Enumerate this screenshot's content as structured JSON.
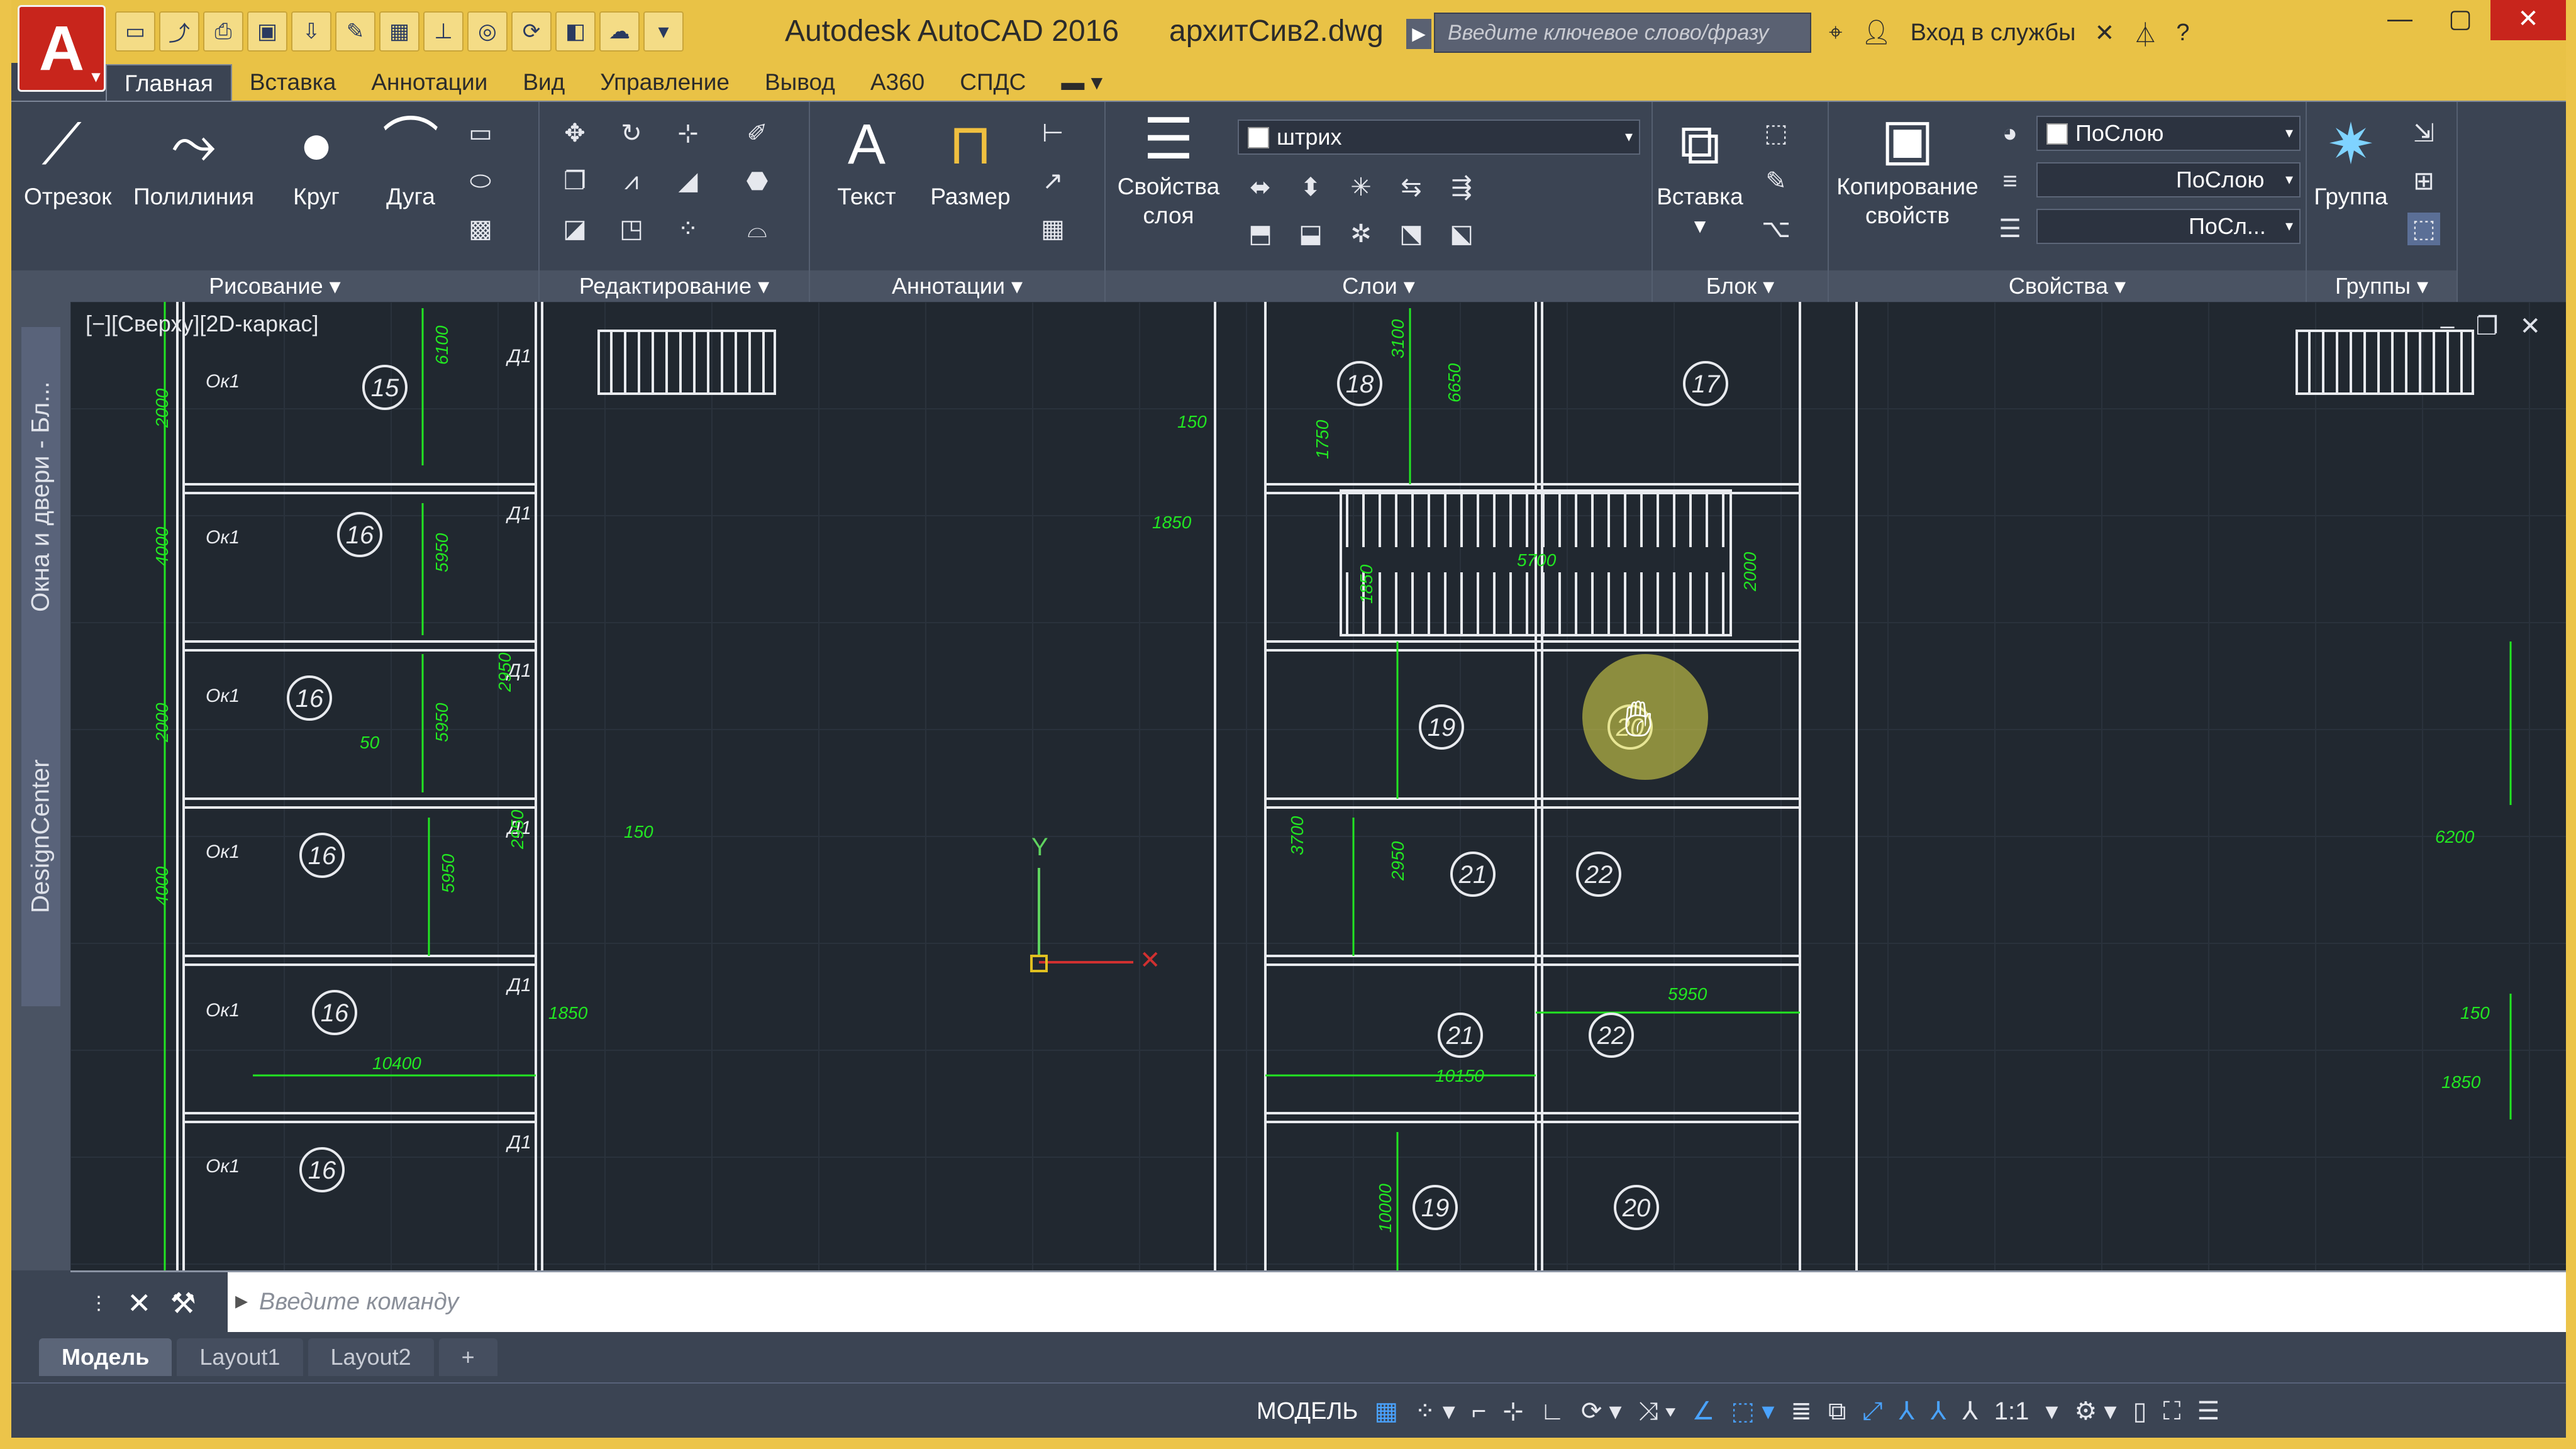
{
  "app": {
    "title": "Autodesk AutoCAD 2016",
    "file": "архитСив2.dwg"
  },
  "qat_icons": [
    "new-icon",
    "open-icon",
    "save-icon",
    "saveas-icon",
    "plot-icon",
    "undo-icon",
    "redo-icon",
    "layout-icon",
    "workspace-icon",
    "share-icon",
    "dropdown-icon"
  ],
  "search": {
    "placeholder": "Введите ключевое слово/фразу"
  },
  "signin": "Вход в службы",
  "tabs": [
    "Главная",
    "Вставка",
    "Аннотации",
    "Вид",
    "Управление",
    "Вывод",
    "A360",
    "СПДС"
  ],
  "ribbon": {
    "draw": {
      "title": "Рисование",
      "line": "Отрезок",
      "polyline": "Полилиния",
      "circle": "Круг",
      "arc": "Дуга"
    },
    "modify": {
      "title": "Редактирование"
    },
    "annotation": {
      "title": "Аннотации",
      "text": "Текст",
      "dimension": "Размер"
    },
    "layers": {
      "title": "Слои",
      "props_line1": "Свойства",
      "props_line2": "слоя",
      "current_layer": "штрих"
    },
    "block": {
      "title": "Блок",
      "insert": "Вставка"
    },
    "properties": {
      "title": "Свойства",
      "match_line1": "Копирование",
      "match_line2": "свойств",
      "color": "ПоСлою",
      "linetype": "ПоСлою",
      "lineweight": "ПоСл..."
    },
    "groups": {
      "title": "Группы",
      "group": "Группа"
    }
  },
  "side_palettes": [
    "Окна и двери - Бл...",
    "DesignCenter"
  ],
  "viewport": {
    "label": "[−][Сверху][2D-каркас]"
  },
  "drawing": {
    "rooms": [
      {
        "num": "15"
      },
      {
        "num": "16"
      },
      {
        "num": "16"
      },
      {
        "num": "16"
      },
      {
        "num": "16"
      },
      {
        "num": "16"
      },
      {
        "num": "18"
      },
      {
        "num": "17"
      },
      {
        "num": "19"
      },
      {
        "num": "20"
      },
      {
        "num": "21"
      },
      {
        "num": "22"
      },
      {
        "num": "21"
      },
      {
        "num": "22"
      },
      {
        "num": "19"
      },
      {
        "num": "20"
      }
    ],
    "window_label": "Ок1",
    "door_label": "Д1",
    "dims": [
      "6100",
      "5950",
      "5950",
      "5950",
      "10400",
      "2950",
      "2950",
      "1850",
      "150",
      "50",
      "3100",
      "6650",
      "1750",
      "1850",
      "150",
      "1850",
      "5700",
      "2000",
      "3700",
      "2950",
      "5950",
      "10150",
      "10000",
      "6200",
      "150",
      "1850",
      "2000",
      "4000",
      "2000",
      "4000"
    ]
  },
  "command": {
    "placeholder": "Введите команду"
  },
  "layout_tabs": [
    "Модель",
    "Layout1",
    "Layout2",
    "+"
  ],
  "status": {
    "model": "МОДЕЛЬ",
    "scale": "1:1"
  },
  "colors": {
    "accent": "#e9c246",
    "ribbon": "#3b4453",
    "canvas": "#212830",
    "dim": "#22e622",
    "line": "#e8eaee"
  }
}
